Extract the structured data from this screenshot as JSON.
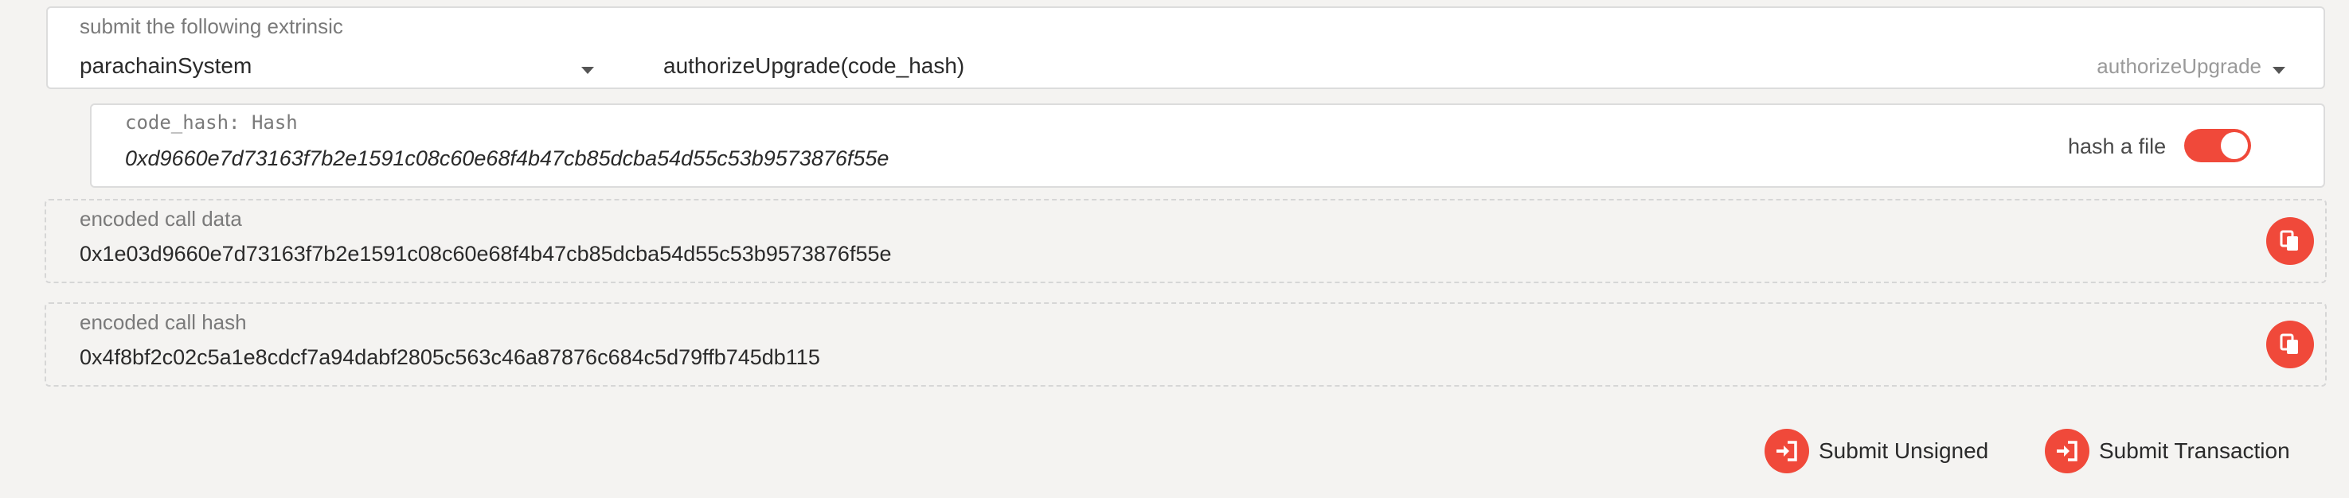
{
  "extrinsic": {
    "label": "submit the following extrinsic",
    "section_value": "parachainSystem",
    "method_value": "authorizeUpgrade(code_hash)",
    "method_hint": "authorizeUpgrade",
    "caret_icon": "chevron-down-icon"
  },
  "param": {
    "label": "code_hash: Hash",
    "value": "0xd9660e7d73163f7b2e1591c08c60e68f4b47cb85dcba54d55c53b9573876f55e",
    "toggle_label": "hash a file",
    "toggle_on": true,
    "accent_color": "#f0493a"
  },
  "encoded_call_data": {
    "label": "encoded call data",
    "value": "0x1e03d9660e7d73163f7b2e1591c08c60e68f4b47cb85dcba54d55c53b9573876f55e",
    "copy_icon": "copy-icon"
  },
  "encoded_call_hash": {
    "label": "encoded call hash",
    "value": "0x4f8bf2c02c5a1e8cdcf7a94dabf2805c563c46a87876c684c5d79ffb745db115",
    "copy_icon": "copy-icon"
  },
  "actions": {
    "submit_unsigned_label": "Submit Unsigned",
    "submit_transaction_label": "Submit Transaction",
    "icon": "sign-in-icon"
  }
}
